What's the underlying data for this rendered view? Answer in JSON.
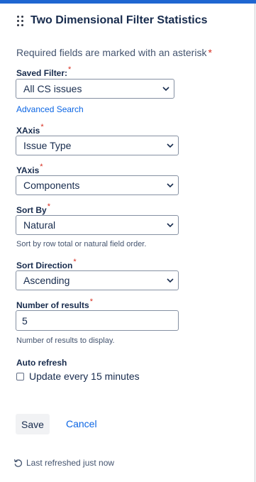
{
  "gadget": {
    "title": "Two Dimensional Filter Statistics",
    "required_note": "Required fields are marked with an asterisk",
    "asterisk": "*"
  },
  "fields": {
    "saved_filter": {
      "label": "Saved Filter:",
      "value": "All CS issues"
    },
    "advanced_search": "Advanced Search",
    "xaxis": {
      "label": "XAxis",
      "value": "Issue Type"
    },
    "yaxis": {
      "label": "YAxis",
      "value": "Components"
    },
    "sort_by": {
      "label": "Sort By",
      "value": "Natural",
      "help": "Sort by row total or natural field order."
    },
    "sort_direction": {
      "label": "Sort Direction",
      "value": "Ascending"
    },
    "num_results": {
      "label": "Number of results",
      "value": "5",
      "help": "Number of results to display."
    },
    "auto_refresh": {
      "label": "Auto refresh",
      "checkbox_label": "Update every 15 minutes",
      "checked": false
    }
  },
  "actions": {
    "save": "Save",
    "cancel": "Cancel"
  },
  "footer": {
    "status": "Last refreshed just now"
  },
  "colors": {
    "accent": "#1f66d1",
    "link": "#0c66e4",
    "required": "#d72c1e",
    "text": "#172b4d",
    "subtle": "#44546f"
  },
  "icons": {
    "drag": "drag-handle-icon",
    "chevron": "chevron-down-icon",
    "refresh": "refresh-icon"
  }
}
